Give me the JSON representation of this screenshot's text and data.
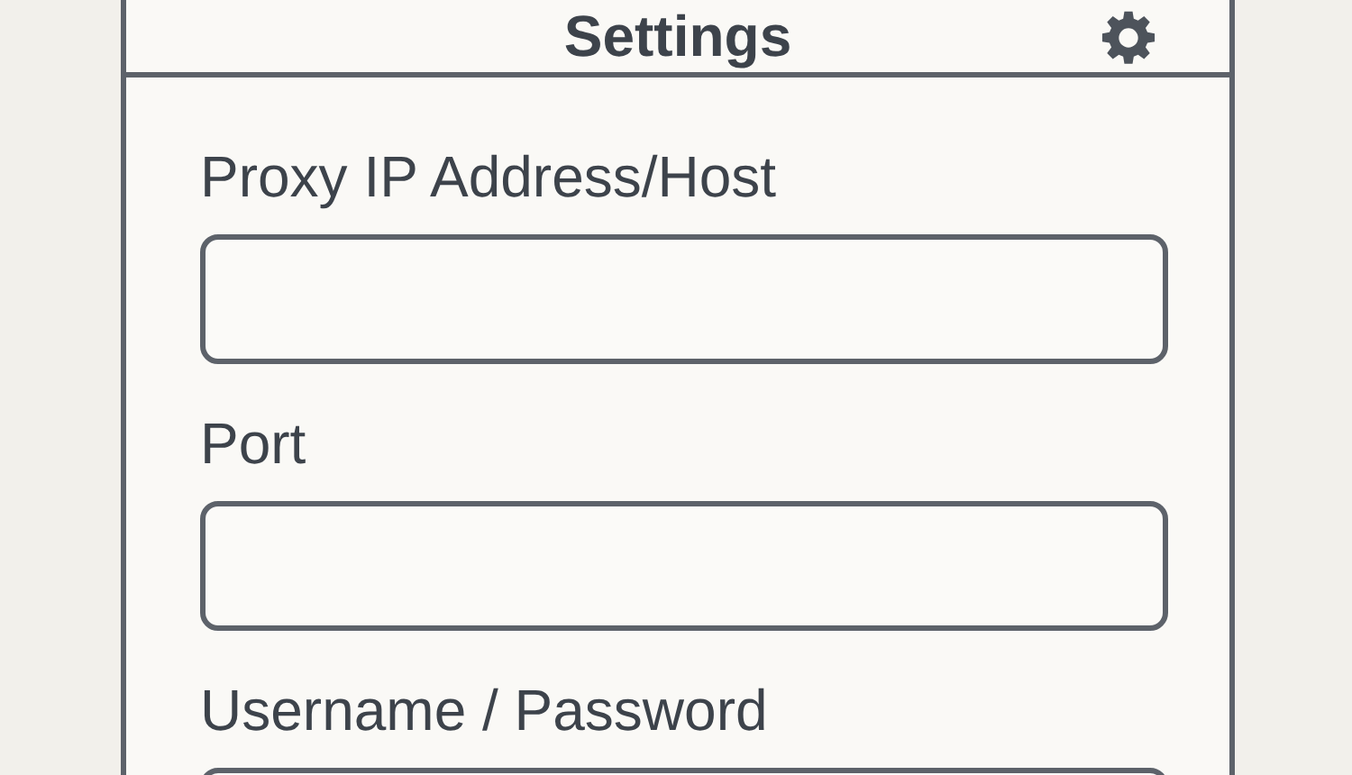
{
  "title": "Settings",
  "fields": [
    {
      "label": "Proxy IP Address/Host"
    },
    {
      "label": "Port"
    },
    {
      "label": "Username / Password"
    }
  ]
}
